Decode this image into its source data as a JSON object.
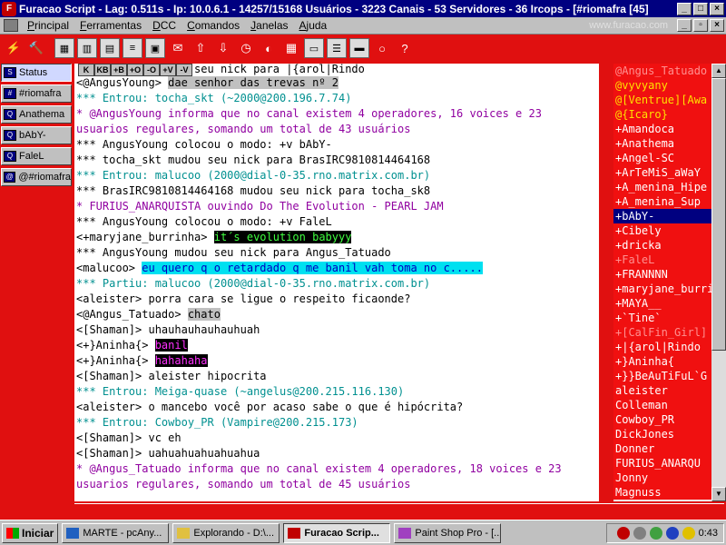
{
  "titlebar": {
    "title": "Furacao Script - Lag: 0.511s - Ip: 10.0.6.1 - 14257/15168 Usuários - 3223 Canais - 53 Servidores - 36 Ircops - [#riomafra [45]",
    "minimize": "_",
    "maximize": "□",
    "close": "×"
  },
  "menubar": {
    "items": [
      "Principal",
      "Ferramentas",
      "DCC",
      "Comandos",
      "Janelas",
      "Ajuda"
    ],
    "watermark": "www.furacao.com"
  },
  "switchbar": {
    "items": [
      {
        "label": "Status"
      },
      {
        "label": "#riomafra"
      },
      {
        "label": "Anathema"
      },
      {
        "label": "bAbY-"
      },
      {
        "label": "FaleL"
      },
      {
        "label": "@#riomafra"
      }
    ]
  },
  "chat": {
    "top_partial": "[<+}Rindo}> mudou seu nick para |{arol|Rindo",
    "lines": [
      {
        "prefix": "<@AngusYoung> ",
        "text": "dae senhor das trevas nº 2",
        "style": "hl-gray",
        "color": ""
      },
      {
        "prefix": "",
        "text": "*** Entrou: tocha_skt (~2000@200.196.7.74)",
        "style": "",
        "color": "c-teal"
      },
      {
        "prefix": "",
        "text": "* @AngusYoung informa que no canal existem 4 operadores, 16 voices e 23 usuarios regulares, somando um total de 43 usuários",
        "style": "",
        "color": "c-purple",
        "two": true
      },
      {
        "prefix": "",
        "text": "*** AngusYoung colocou o modo: +v bAbY-",
        "style": "",
        "color": ""
      },
      {
        "prefix": "",
        "text": "*** tocha_skt mudou seu nick para BrasIRC9810814464168",
        "style": "",
        "color": ""
      },
      {
        "prefix": "",
        "text": "*** Entrou: malucoo (2000@dial-0-35.rno.matrix.com.br)",
        "style": "",
        "color": "c-teal"
      },
      {
        "prefix": "",
        "text": "*** BrasIRC9810814464168 mudou seu nick para tocha_sk8",
        "style": "",
        "color": ""
      },
      {
        "prefix": "",
        "text": "* FURIUS_ANARQUISTA ouvindo Do The Evolution - PEARL JAM",
        "style": "",
        "color": "c-purple"
      },
      {
        "prefix": "",
        "text": "*** AngusYoung colocou o modo: +v FaleL",
        "style": "",
        "color": ""
      },
      {
        "prefix": "<+maryjane_burrinha> ",
        "text": "it´s evolution babyyy",
        "style": "hl-green",
        "color": ""
      },
      {
        "prefix": "",
        "text": "*** AngusYoung mudou seu nick para Angus_Tatuado",
        "style": "",
        "color": ""
      },
      {
        "prefix": "<malucoo> ",
        "text": "eu quero q o retardado q me banil vah toma no c.....",
        "style": "hl-cyan",
        "color": ""
      },
      {
        "prefix": "",
        "text": "*** Partiu: malucoo (2000@dial-0-35.rno.matrix.com.br)",
        "style": "",
        "color": "c-teal"
      },
      {
        "prefix": "",
        "text": "<aleister> porra cara se ligue o respeito ficaonde?",
        "style": "",
        "color": ""
      },
      {
        "prefix": "<@Angus_Tatuado> ",
        "text": "chato",
        "style": "hl-gray",
        "color": ""
      },
      {
        "prefix": "",
        "text": "<[Shaman]> uhauhauhauhauhuah",
        "style": "",
        "color": ""
      },
      {
        "prefix": "<+}Aninha{> ",
        "text": "banil",
        "style": "hl-mag",
        "color": ""
      },
      {
        "prefix": "<+}Aninha{> ",
        "text": "hahahaha",
        "style": "hl-mag",
        "color": ""
      },
      {
        "prefix": "",
        "text": "<[Shaman]> aleister hipocrita",
        "style": "",
        "color": ""
      },
      {
        "prefix": "",
        "text": "*** Entrou: Meiga-quase (~angelus@200.215.116.130)",
        "style": "",
        "color": "c-teal"
      },
      {
        "prefix": "",
        "text": "<aleister> o mancebo você por acaso sabe o que é hipócrita?",
        "style": "",
        "color": ""
      },
      {
        "prefix": "",
        "text": "*** Entrou: Cowboy_PR (Vampire@200.215.173)",
        "style": "",
        "color": "c-teal"
      },
      {
        "prefix": "",
        "text": "<[Shaman]> vc eh",
        "style": "",
        "color": ""
      },
      {
        "prefix": "",
        "text": "<[Shaman]> uahuahuahuahuahua",
        "style": "",
        "color": ""
      },
      {
        "prefix": "",
        "text": "* @Angus_Tatuado informa que no canal existem 4 operadores, 18 voices e 23 usuarios regulares, somando um total de 45 usuários",
        "style": "",
        "color": "c-purple",
        "two": true
      }
    ]
  },
  "nicklist": {
    "nicks": [
      {
        "name": "@Angus_Tatuado",
        "type": "voice-dim"
      },
      {
        "name": "@vyvyany",
        "type": "op"
      },
      {
        "name": "@[Ventrue][Awa",
        "type": "op"
      },
      {
        "name": "@{Icaro}",
        "type": "op"
      },
      {
        "name": "+Amandoca",
        "type": "voice"
      },
      {
        "name": "+Anathema",
        "type": "voice"
      },
      {
        "name": "+Angel-SC",
        "type": "voice"
      },
      {
        "name": "+ArTeMiS_aWaY",
        "type": "voice"
      },
      {
        "name": "+A_menina_Hipe",
        "type": "voice"
      },
      {
        "name": "+A_menina_Sup",
        "type": "voice"
      },
      {
        "name": "+bAbY-",
        "type": "selected"
      },
      {
        "name": "+Cibely",
        "type": "voice"
      },
      {
        "name": "+dricka",
        "type": "voice"
      },
      {
        "name": "+FaleL",
        "type": "voice-dim"
      },
      {
        "name": "+FRANNNN",
        "type": "voice"
      },
      {
        "name": "+maryjane_burri",
        "type": "voice"
      },
      {
        "name": "+MAYA__",
        "type": "voice"
      },
      {
        "name": "+`Tine`",
        "type": "voice"
      },
      {
        "name": "+[CalFin_Girl]",
        "type": "voice-dim"
      },
      {
        "name": "+|{arol|Rindo",
        "type": "voice"
      },
      {
        "name": "+}Aninha{",
        "type": "voice"
      },
      {
        "name": "+}}BeAuTiFuL`G",
        "type": "voice"
      },
      {
        "name": "aleister",
        "type": "reg"
      },
      {
        "name": "Colleman",
        "type": "reg"
      },
      {
        "name": "Cowboy_PR",
        "type": "reg"
      },
      {
        "name": "DickJones",
        "type": "reg"
      },
      {
        "name": "Donner",
        "type": "reg"
      },
      {
        "name": "FURIUS_ANARQU",
        "type": "reg"
      },
      {
        "name": "Jonny",
        "type": "reg"
      },
      {
        "name": "Magnuss",
        "type": "reg"
      }
    ]
  },
  "taskbar": {
    "start": "Iniciar",
    "tasks": [
      {
        "label": "MARTE - pcAny..."
      },
      {
        "label": "Explorando - D:\\..."
      },
      {
        "label": "Furacao Scrip..."
      },
      {
        "label": "Paint Shop Pro - [..."
      }
    ],
    "clock": "0:43"
  },
  "colors": {
    "accent": "#e01010",
    "titlebar": "#000080"
  }
}
